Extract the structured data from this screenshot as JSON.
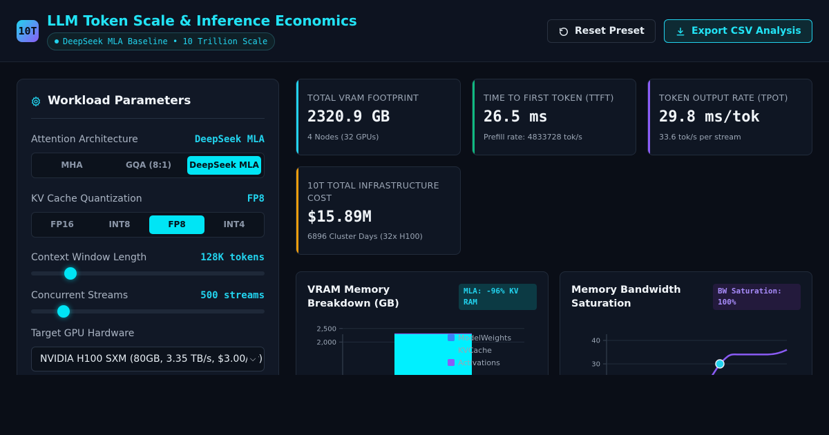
{
  "header": {
    "logo": "10T",
    "title": "LLM Token Scale & Inference Economics",
    "subtitle": "DeepSeek MLA Baseline • 10 Trillion Scale",
    "reset_label": "Reset Preset",
    "export_label": "Export CSV Analysis",
    "reset_icon": "rotate-ccw-icon",
    "export_icon": "download-icon"
  },
  "params": {
    "title": "Workload Parameters",
    "title_icon": "gear-icon",
    "attention": {
      "label": "Attention Architecture",
      "value": "DeepSeek MLA",
      "options": [
        "MHA",
        "GQA (8:1)",
        "DeepSeek MLA"
      ],
      "selected": "DeepSeek MLA"
    },
    "quant": {
      "label": "KV Cache Quantization",
      "value": "FP8",
      "options": [
        "FP16",
        "INT8",
        "FP8",
        "INT4"
      ],
      "selected": "FP8"
    },
    "context": {
      "label": "Context Window Length",
      "value": "128K tokens",
      "level": 0.15
    },
    "streams": {
      "label": "Concurrent Streams",
      "value": "500 streams",
      "level": 0.12
    },
    "gpu": {
      "label": "Target GPU Hardware",
      "value": "NVIDIA H100 SXM (80GB, 3.35 TB/s, $3.00/hr)"
    }
  },
  "metrics": [
    {
      "label": "TOTAL VRAM FOOTPRINT",
      "value": "2320.9 GB",
      "sub": "4 Nodes (32 GPUs)",
      "color": "#22d3ee"
    },
    {
      "label": "TIME TO FIRST TOKEN (TTFT)",
      "value": "26.5 ms",
      "sub": "Prefill rate: 4833728 tok/s",
      "color": "#10b981"
    },
    {
      "label": "TOKEN OUTPUT RATE (TPOT)",
      "value": "29.8 ms/tok",
      "sub": "33.6 tok/s per stream",
      "color": "#8b5cf6"
    },
    {
      "label": "10T TOTAL INFRASTRUCTURE COST",
      "value": "$15.89M",
      "sub": "6896 Cluster Days (32x H100)",
      "color": "#f59e0b"
    }
  ],
  "vram_chart": {
    "title": "VRAM Memory Breakdown (GB)",
    "badge": "MLA: -96% KV RAM",
    "badge_color": "#22d3ee"
  },
  "bw_chart": {
    "title": "Memory Bandwidth Saturation",
    "badge": "BW Saturation: 100%",
    "badge_color": "#a78bfa"
  },
  "chart_data": [
    {
      "type": "bar",
      "title": "VRAM Memory Breakdown (GB)",
      "stacked": true,
      "yticks": [
        "2,500",
        "2,000"
      ],
      "ylim": [
        0,
        2800
      ],
      "series": [
        {
          "name": "ModelWeights",
          "color": "#3b82f6",
          "values": [
            20
          ]
        },
        {
          "name": "KVCache",
          "color": "#00f0ff",
          "values": [
            2280
          ]
        },
        {
          "name": "Activations",
          "color": "#8b5cf6",
          "values": [
            20
          ]
        }
      ],
      "legend": "top-right",
      "grid": true
    },
    {
      "type": "line",
      "title": "Memory Bandwidth Saturation",
      "yticks": [
        "40",
        "30"
      ],
      "ylim": [
        0,
        43
      ],
      "series": [
        {
          "color": "#8b5cf6",
          "values": [
            20,
            30,
            34,
            34,
            36
          ]
        }
      ],
      "highlight_point": 30,
      "grid": true
    }
  ]
}
